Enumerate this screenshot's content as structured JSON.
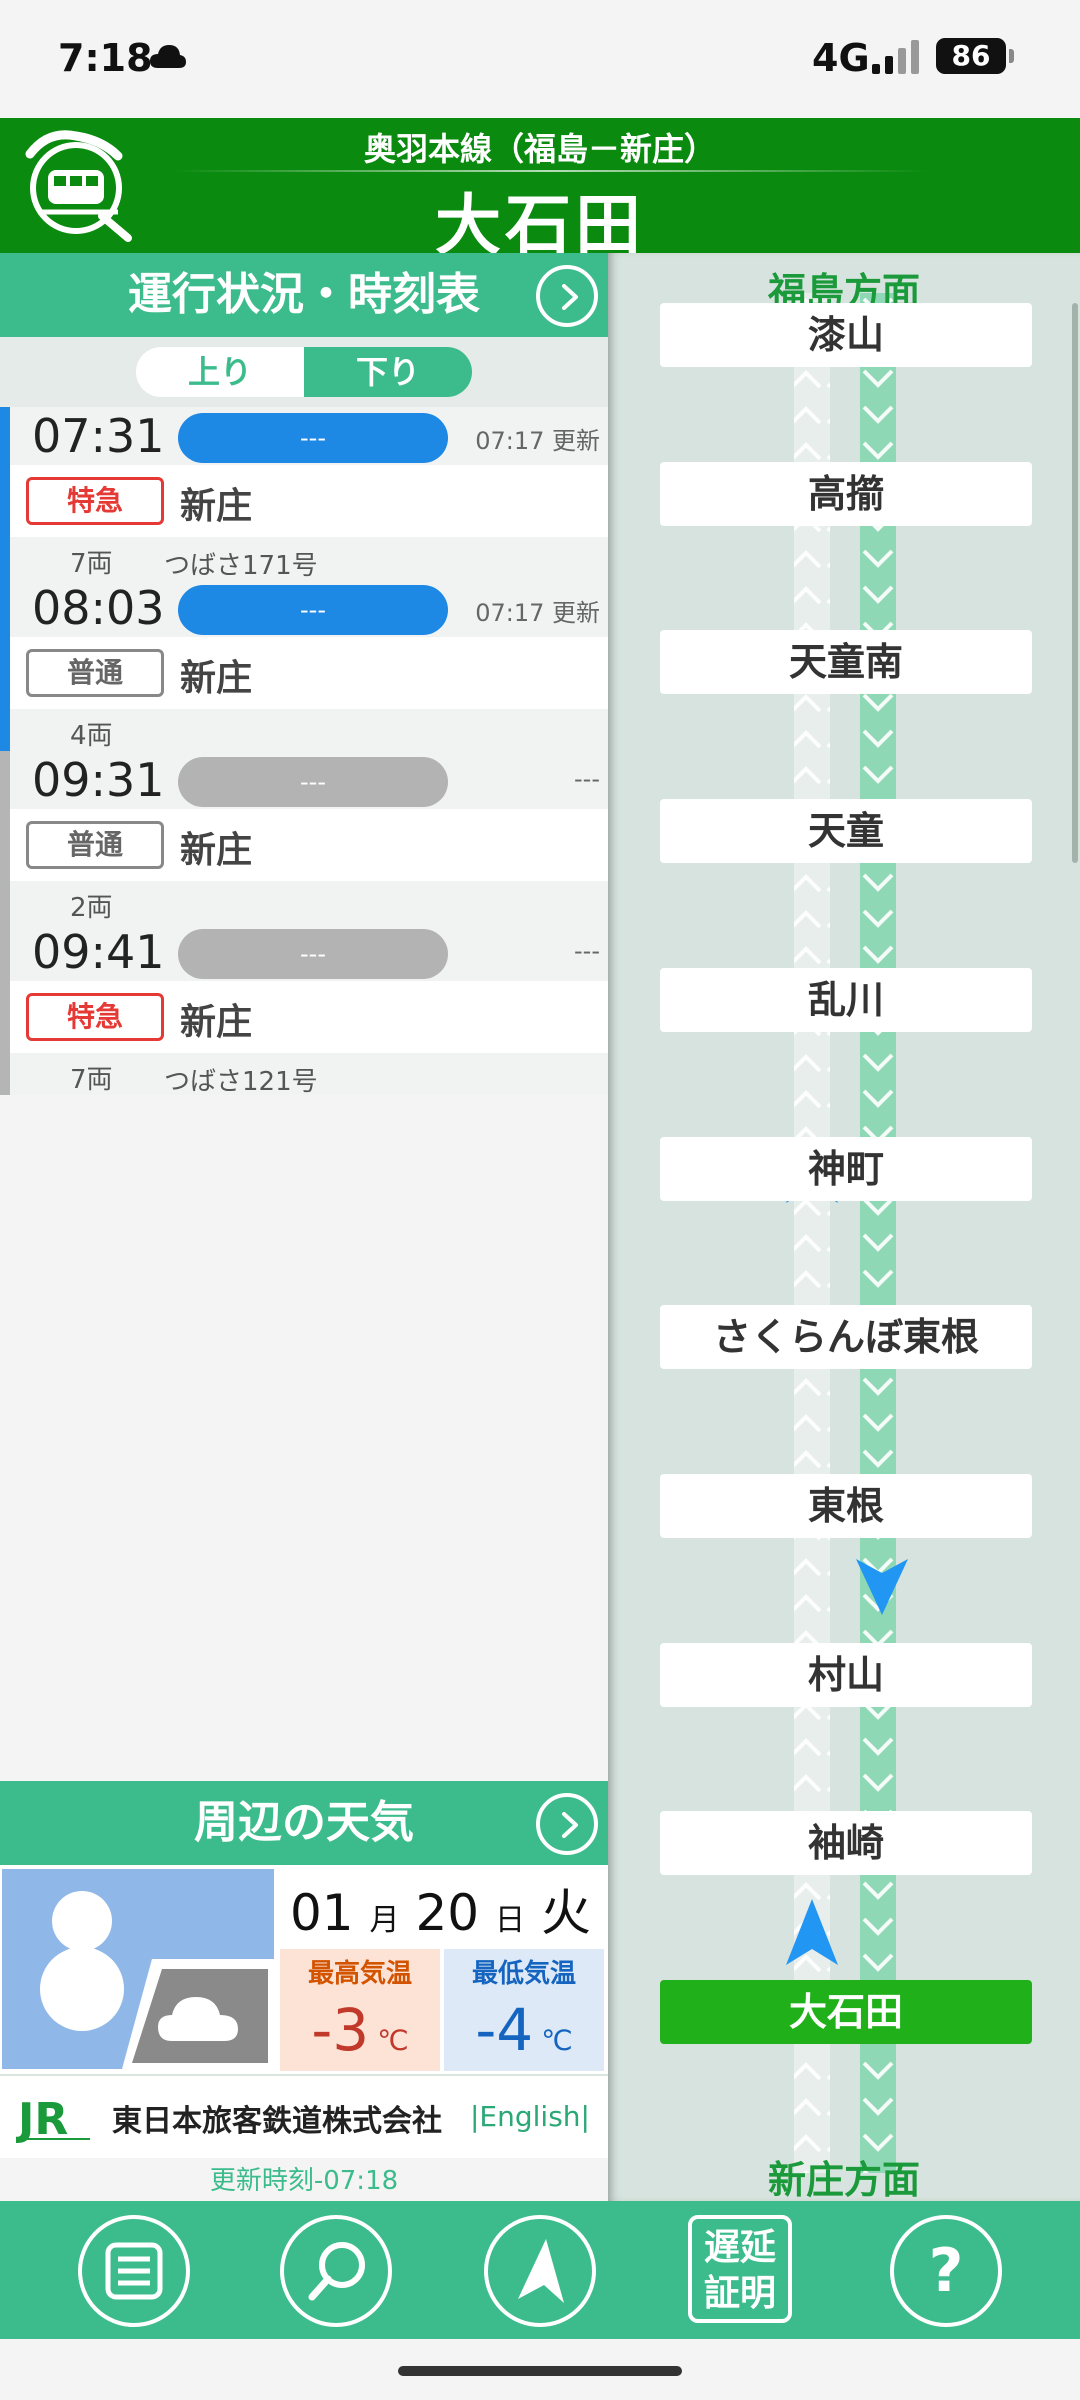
{
  "status_bar": {
    "time": "7:18",
    "network": "4G",
    "battery": "86"
  },
  "header": {
    "line_name": "奥羽本線（福島－新庄）",
    "station": "大石田"
  },
  "timetable": {
    "title": "運行状況・時刻表",
    "direction_up": "上り",
    "direction_down": "下り",
    "trains": [
      {
        "time": "07:31",
        "status": "---",
        "updated": "07:17 更新",
        "type": "特急",
        "destination": "新庄",
        "cars": "7両",
        "name": "つばさ171号"
      },
      {
        "time": "08:03",
        "status": "---",
        "updated": "07:17 更新",
        "type": "普通",
        "destination": "新庄",
        "cars": "4両",
        "name": ""
      },
      {
        "time": "09:31",
        "status": "---",
        "updated": "---",
        "type": "普通",
        "destination": "新庄",
        "cars": "2両",
        "name": ""
      },
      {
        "time": "09:41",
        "status": "---",
        "updated": "---",
        "type": "特急",
        "destination": "新庄",
        "cars": "7両",
        "name": "つばさ121号"
      }
    ]
  },
  "weather": {
    "title": "周辺の天気",
    "month": "01",
    "month_unit": "月",
    "day": "20",
    "day_unit": "日",
    "weekday": "火",
    "high_label": "最高気温",
    "high": "-3",
    "low_label": "最低気温",
    "low": "-4",
    "unit": "℃"
  },
  "footer": {
    "company": "東日本旅客鉄道株式会社",
    "english": "|English|",
    "updated": "更新時刻-07:18"
  },
  "route": {
    "top_direction": "福島方面",
    "bottom_direction": "新庄方面",
    "stations": [
      "漆山",
      "高擶",
      "天童南",
      "天童",
      "乱川",
      "神町",
      "さくらんぼ東根",
      "東根",
      "村山",
      "袖崎",
      "大石田"
    ],
    "current_station": "大石田"
  },
  "bottom_nav": {
    "delay_cert": "遅延証明",
    "help": "?"
  },
  "colors": {
    "header_green": "#0a8a0e",
    "accent_teal": "#3cbc8c",
    "status_blue": "#1e88e5",
    "express_red": "#e53935",
    "current_station": "#1fb01a"
  }
}
